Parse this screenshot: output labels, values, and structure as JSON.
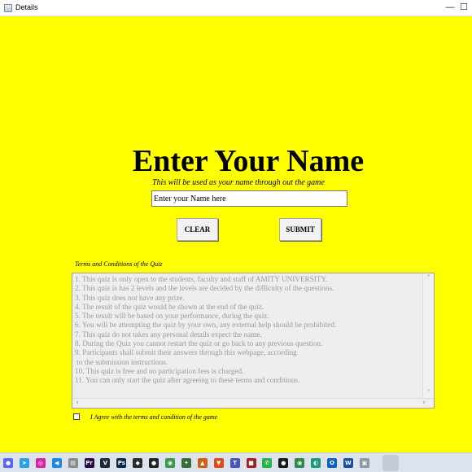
{
  "window": {
    "title": "Details",
    "controls": {
      "minimize": "—",
      "maximize": "☐"
    }
  },
  "main": {
    "heading": "Enter Your Name",
    "subheading": "This will be used as your name through out the game",
    "name_input": {
      "value": "Enter your Name here"
    },
    "clear_label": "CLEAR",
    "submit_label": "SUBMIT"
  },
  "terms": {
    "title": "Terms and Conditions of the Quiz",
    "text": "1. This quiz is only open to the students, faculty and staff of AMITY UNIVERSITY.\n2. This quiz is has 2 levels and the levels are decided by the difficulty of the questions.\n3. This quiz does not have any prize.\n4. The result of the quiz would be shown at the end of the quiz.\n5. The result will be based on your performance, during the quiz.\n6. You will be attempting the quiz by your own, any external help should be prohibited.\n7. This quiz do not takes any personal details expect the name.\n8. During the Quiz you cannot restart the quiz or go back to any previous question.\n9. Participants shall submit their answers through this webpage, according\n to the submission instructions.\n10. This quiz is free and no participation fess is charged.\n11. You can only start the quiz after agreeing to these terms and conditions.",
    "agree_label": "I Agree with the terms and condition of the game",
    "agree_checked": false
  },
  "taskbar": {
    "icons": [
      {
        "name": "discord-icon",
        "color": "#5865f2",
        "glyph": "●"
      },
      {
        "name": "telegram-icon",
        "color": "#2aa3dd",
        "glyph": "➤"
      },
      {
        "name": "instagram-icon",
        "color": "#d6249f",
        "glyph": "◎"
      },
      {
        "name": "vscode-icon",
        "color": "#1e88e5",
        "glyph": "◀"
      },
      {
        "name": "files-icon",
        "color": "#8a8a8a",
        "glyph": "▤"
      },
      {
        "name": "premiere-icon",
        "color": "#2a0a4a",
        "glyph": "Pr"
      },
      {
        "name": "vegas-icon",
        "color": "#1b2a3a",
        "glyph": "V"
      },
      {
        "name": "photoshop-icon",
        "color": "#0a2a4a",
        "glyph": "Ps"
      },
      {
        "name": "app-icon",
        "color": "#2b2b2b",
        "glyph": "◆"
      },
      {
        "name": "github-icon",
        "color": "#222222",
        "glyph": "●"
      },
      {
        "name": "chrome-icon",
        "color": "#3b9a4a",
        "glyph": "◉"
      },
      {
        "name": "settings-icon",
        "color": "#3a6a3a",
        "glyph": "✦"
      },
      {
        "name": "vlc-icon",
        "color": "#d06010",
        "glyph": "▲"
      },
      {
        "name": "brave-icon",
        "color": "#e04a1a",
        "glyph": "▼"
      },
      {
        "name": "teams-icon",
        "color": "#4b53bc",
        "glyph": "T"
      },
      {
        "name": "app-icon-2",
        "color": "#a02020",
        "glyph": "■"
      },
      {
        "name": "whatsapp-icon",
        "color": "#25b34a",
        "glyph": "✆"
      },
      {
        "name": "player-icon",
        "color": "#1a1a1a",
        "glyph": "●"
      },
      {
        "name": "chrome-icon-2",
        "color": "#2b8a4a",
        "glyph": "◉"
      },
      {
        "name": "edge-icon",
        "color": "#1a9a7a",
        "glyph": "◐"
      },
      {
        "name": "outlook-icon",
        "color": "#0a64c0",
        "glyph": "O"
      },
      {
        "name": "word-icon",
        "color": "#1a4fa0",
        "glyph": "W"
      },
      {
        "name": "java-app-icon",
        "color": "#8a9aaa",
        "glyph": "▣"
      }
    ]
  }
}
